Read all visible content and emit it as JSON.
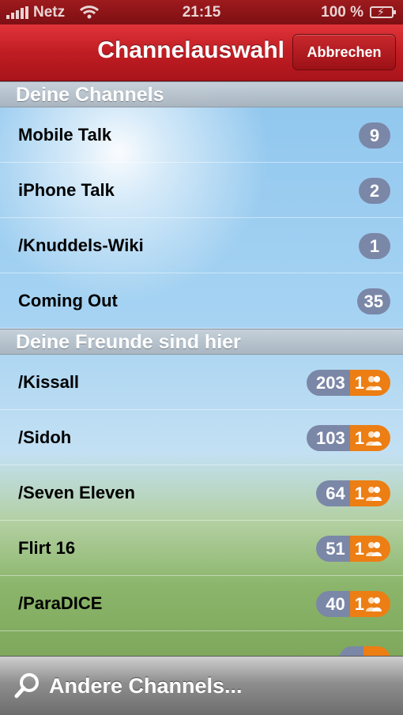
{
  "status_bar": {
    "carrier": "Netz",
    "time": "21:15",
    "battery": "100 %"
  },
  "nav": {
    "title": "Channelauswahl",
    "cancel_label": "Abbrechen"
  },
  "sections": [
    {
      "header": "Deine Channels",
      "items": [
        {
          "label": "Mobile Talk",
          "count": "9"
        },
        {
          "label": "iPhone Talk",
          "count": "2"
        },
        {
          "label": "/Knuddels-Wiki",
          "count": "1"
        },
        {
          "label": "Coming Out",
          "count": "35"
        }
      ]
    },
    {
      "header": "Deine Freunde sind hier",
      "items": [
        {
          "label": "/Kissall",
          "count": "203",
          "friends": "1"
        },
        {
          "label": "/Sidoh",
          "count": "103",
          "friends": "1"
        },
        {
          "label": "/Seven Eleven",
          "count": "64",
          "friends": "1"
        },
        {
          "label": "Flirt 16",
          "count": "51",
          "friends": "1"
        },
        {
          "label": "/ParaDICE",
          "count": "40",
          "friends": "1"
        }
      ]
    }
  ],
  "search": {
    "label": "Andere Channels..."
  },
  "colors": {
    "nav_red": "#bf1d23",
    "count_badge": "#7b87a7",
    "friends_badge": "#ec7e14"
  }
}
